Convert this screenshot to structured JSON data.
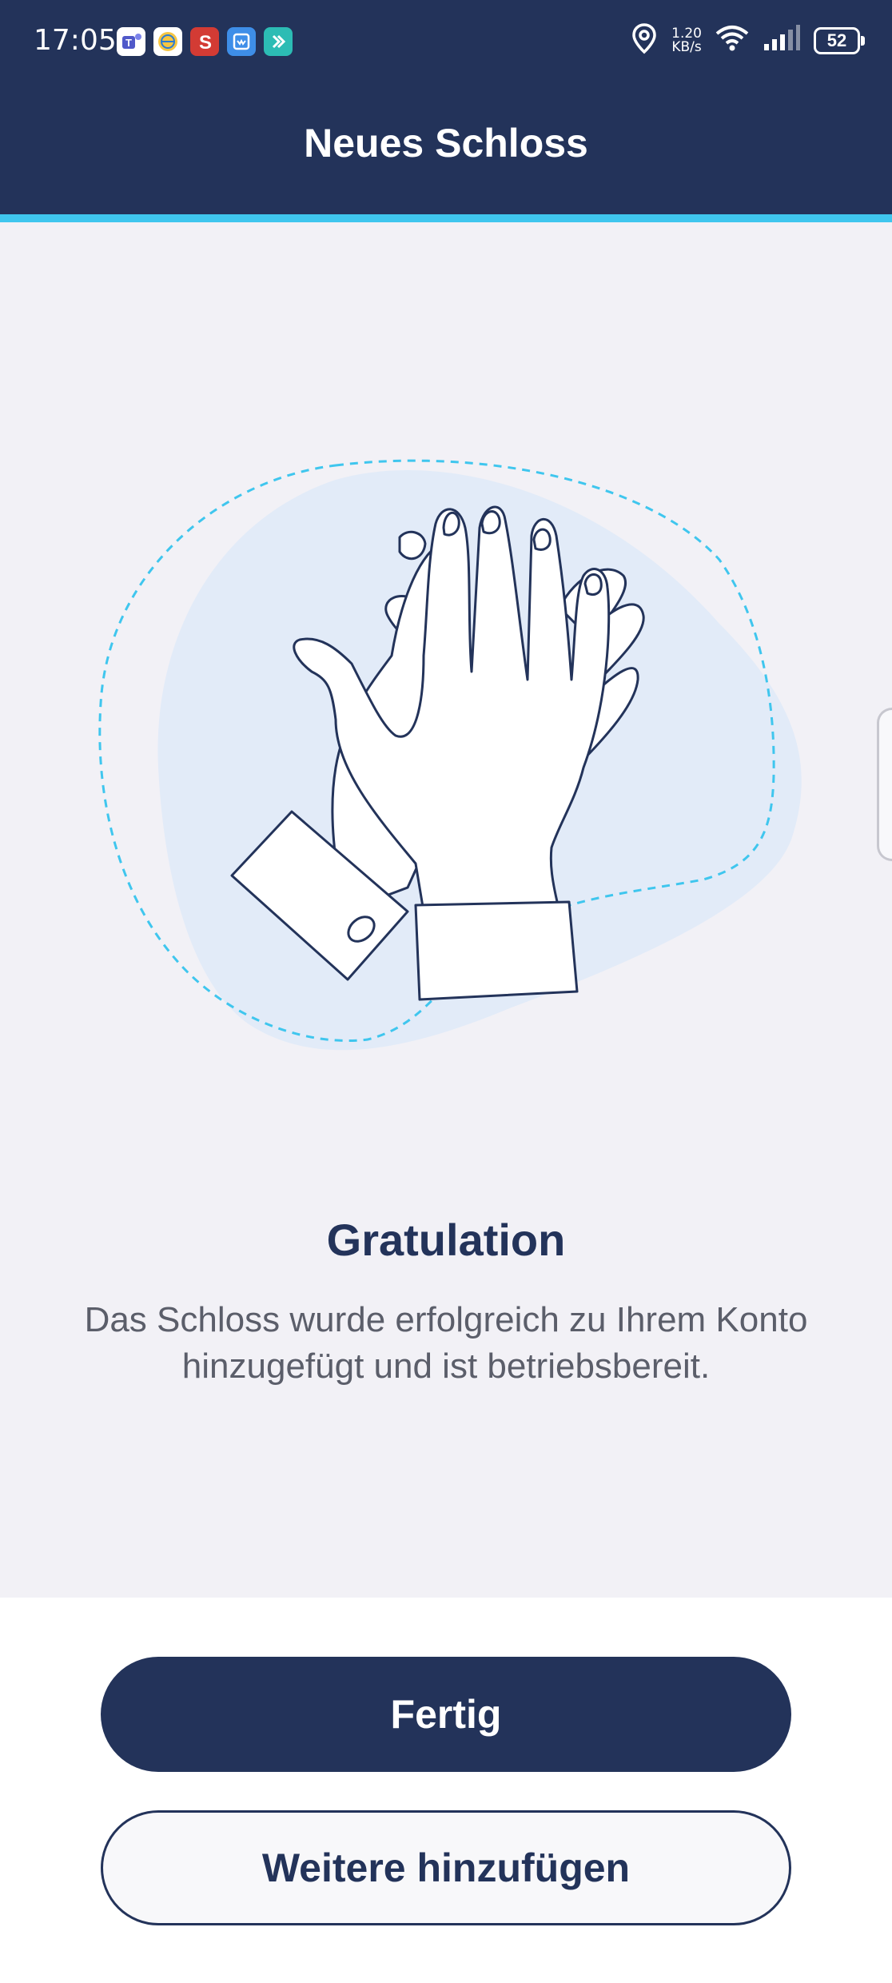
{
  "status_bar": {
    "time": "17:05",
    "speed_value": "1.20",
    "speed_unit": "KB/s",
    "battery": "52",
    "icons": [
      "teams-icon",
      "globe-app-icon",
      "s-app-icon",
      "calendar-app-icon",
      "arrow-app-icon",
      "location-icon",
      "wifi-icon",
      "signal-icon",
      "battery-icon"
    ]
  },
  "header": {
    "title": "Neues Schloss"
  },
  "content": {
    "illustration": "clapping-hands-illustration",
    "heading": "Gratulation",
    "message": "Das Schloss wurde erfolgreich zu Ihrem Konto hinzugefügt und ist betriebsbereit."
  },
  "actions": {
    "primary_label": "Fertig",
    "secondary_label": "Weitere hinzufügen"
  },
  "colors": {
    "header_bg": "#23335a",
    "accent": "#3fc6ee",
    "background": "#f2f1f6",
    "blob": "#e2ebf8"
  }
}
